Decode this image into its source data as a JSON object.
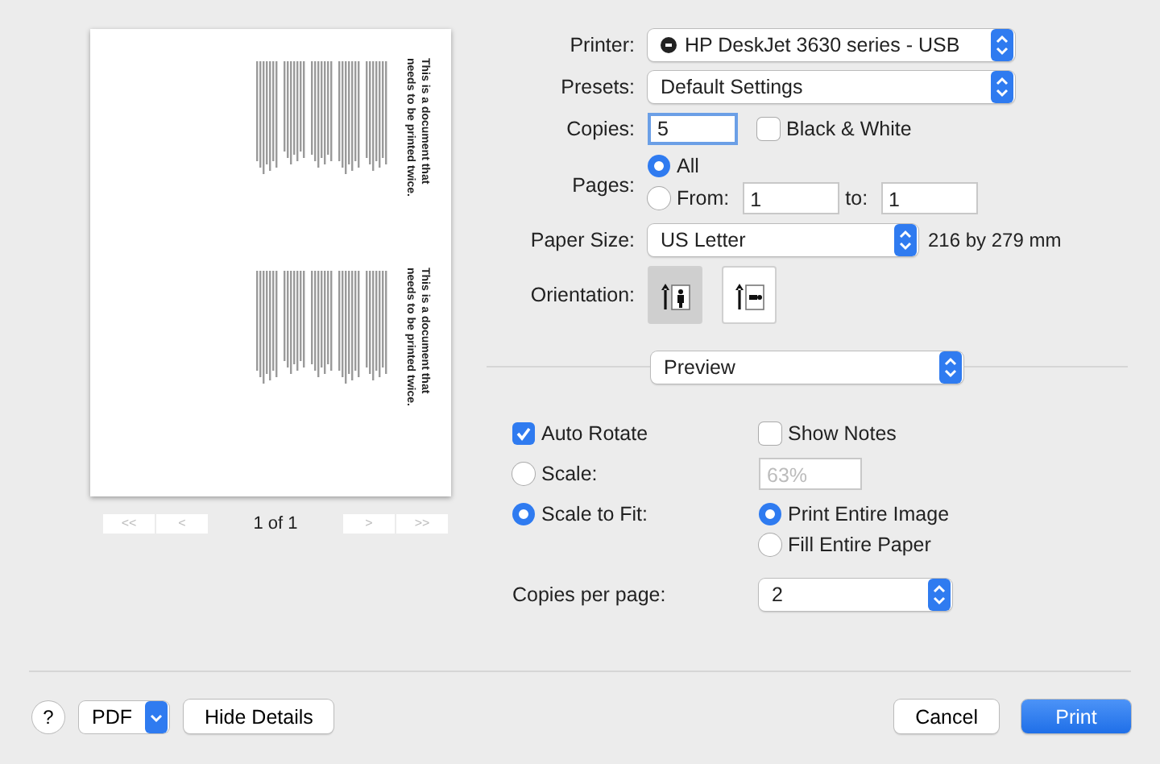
{
  "preview": {
    "blocks": [
      {
        "heading": "This is a document that needs to be printed twice."
      },
      {
        "heading": "This is a document that needs to be printed twice."
      }
    ],
    "nav": [
      {
        "label": "<<",
        "disabled": true
      },
      {
        "label": "<",
        "disabled": true
      },
      {
        "label": ">",
        "disabled": true
      },
      {
        "label": ">>",
        "disabled": true
      }
    ],
    "page_label": "1 of 1"
  },
  "printer": {
    "label": "Printer:",
    "value": "HP DeskJet 3630 series - USB"
  },
  "presets": {
    "label": "Presets:",
    "value": "Default Settings"
  },
  "copies": {
    "label": "Copies:",
    "value": "5",
    "focused": true
  },
  "black_white": {
    "label": "Black & White",
    "checked": false
  },
  "pages": {
    "label": "Pages:",
    "all": {
      "label": "All",
      "selected": true
    },
    "range": {
      "label": "From:",
      "selected": false,
      "from": "1",
      "to_label": "to:",
      "to": "1"
    }
  },
  "paper_size": {
    "label": "Paper Size:",
    "value": "US Letter",
    "note": "216 by 279 mm"
  },
  "orientation": {
    "label": "Orientation:",
    "options": [
      {
        "kind": "portrait",
        "selected": true
      },
      {
        "kind": "landscape",
        "selected": false
      }
    ]
  },
  "section": {
    "value": "Preview"
  },
  "options": {
    "auto_rotate": {
      "label": "Auto Rotate",
      "checked": true
    },
    "show_notes": {
      "label": "Show Notes",
      "checked": false
    },
    "scale": {
      "label": "Scale:",
      "selected": false,
      "value": "63%",
      "disabled": true
    },
    "scale_to_fit": {
      "label": "Scale to Fit:",
      "selected": true,
      "choices": [
        {
          "label": "Print Entire Image",
          "selected": true
        },
        {
          "label": "Fill Entire Paper",
          "selected": false
        }
      ]
    },
    "copies_per_page": {
      "label": "Copies per page:",
      "value": "2"
    }
  },
  "footer": {
    "help": "?",
    "pdf": "PDF",
    "hide_details": "Hide Details",
    "cancel": "Cancel",
    "print": "Print"
  }
}
